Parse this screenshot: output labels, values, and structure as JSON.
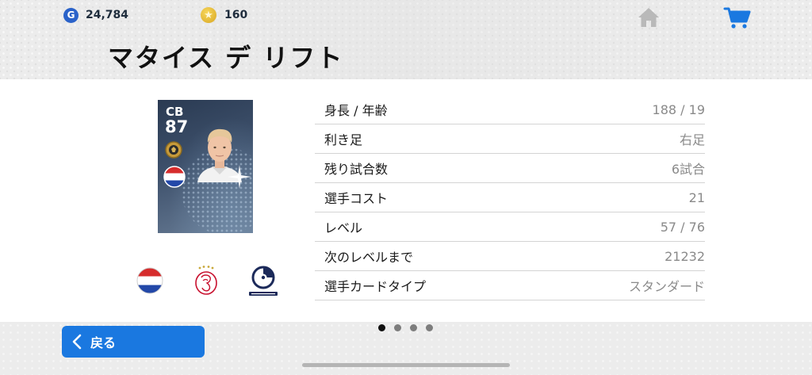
{
  "currency": {
    "gp_icon_letter": "G",
    "gp_amount": "24,784",
    "coin_icon": "★",
    "coins": "160"
  },
  "header": {
    "player_name": "マタイス デ リフト",
    "home_icon": "home-icon",
    "cart_icon": "cart-icon"
  },
  "card": {
    "position": "CB",
    "rating": "87"
  },
  "stats": [
    {
      "label": "身長 / 年齢",
      "value": "188 / 19"
    },
    {
      "label": "利き足",
      "value": "右足"
    },
    {
      "label": "残り試合数",
      "value": "6試合"
    },
    {
      "label": "選手コスト",
      "value": "21"
    },
    {
      "label": "レベル",
      "value": "57 / 76"
    },
    {
      "label": "次のレベルまで",
      "value": "21232"
    },
    {
      "label": "選手カードタイプ",
      "value": "スタンダード"
    }
  ],
  "footer": {
    "back_label": "戻る",
    "pages_total": 4,
    "current_page": 1
  },
  "colors": {
    "accent": "#1a78e0",
    "cart_blue": "#1a78e0",
    "gp_blue": "#2a62c9",
    "coin_gold": "#e0b12d"
  }
}
